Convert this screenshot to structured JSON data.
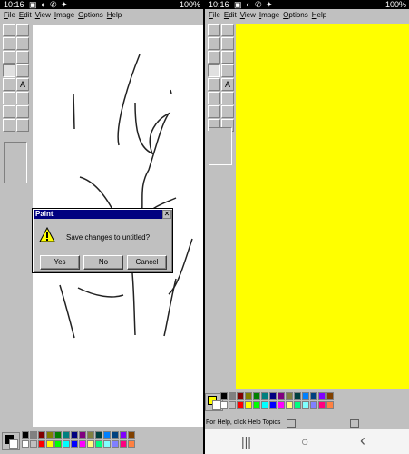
{
  "status_bar": {
    "time": "10:16",
    "icons": "▣ ◐ ✆ ✦",
    "battery": "100%"
  },
  "menu": [
    "File",
    "Edit",
    "View",
    "Image",
    "Options",
    "Help"
  ],
  "tools": [
    "free-select",
    "select",
    "eraser",
    "fill",
    "color-picker",
    "magnifier",
    "pencil",
    "brush",
    "airbrush",
    "text",
    "line",
    "curve",
    "rectangle",
    "polygon",
    "ellipse",
    "rounded-rectangle"
  ],
  "tool_glyphs": {
    "text": "A"
  },
  "dialog": {
    "title": "Paint",
    "close": "✕",
    "message": "Save changes to untitled?",
    "buttons": {
      "yes": "Yes",
      "no": "No",
      "cancel": "Cancel"
    }
  },
  "palette": [
    "#000000",
    "#808080",
    "#800000",
    "#808000",
    "#008000",
    "#008080",
    "#000080",
    "#800080",
    "#808040",
    "#004040",
    "#0080ff",
    "#004080",
    "#8000ff",
    "#804000",
    "#ffffff",
    "#c0c0c0",
    "#ff0000",
    "#ffff00",
    "#00ff00",
    "#00ffff",
    "#0000ff",
    "#ff00ff",
    "#ffff80",
    "#00ff80",
    "#80ffff",
    "#8080ff",
    "#ff0080",
    "#ff8040"
  ],
  "left_window": {
    "foreground": "#000000",
    "background": "#ffffff",
    "canvas": "#ffffff"
  },
  "right_window": {
    "foreground": "#ffff00",
    "background": "#ffffff",
    "canvas": "#ffff00",
    "status_text": "For Help, click Help Topics"
  },
  "navbar": {
    "recent": "|||",
    "home": "○",
    "back": "‹"
  }
}
